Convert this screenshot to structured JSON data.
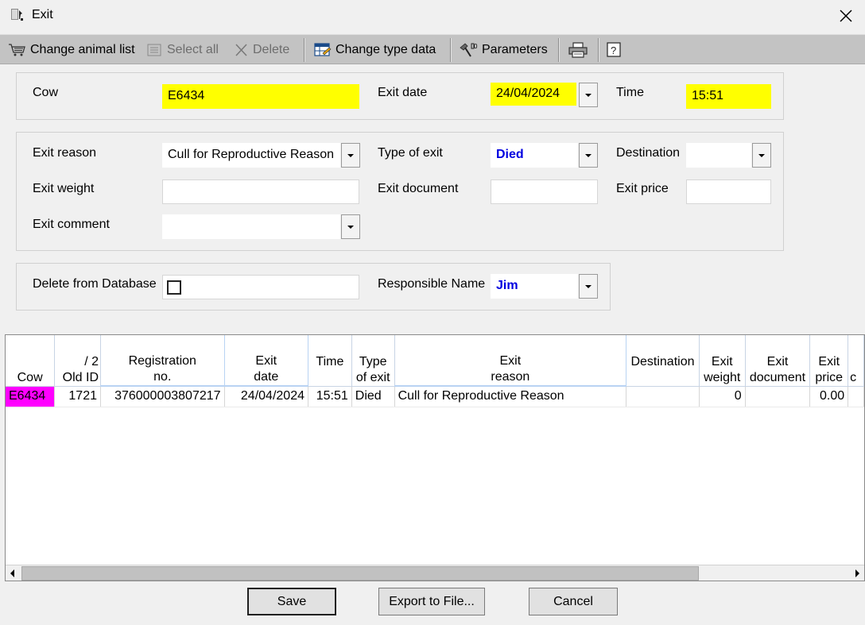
{
  "window": {
    "title": "Exit"
  },
  "toolbar": {
    "change_animal_list": "Change animal list",
    "select_all": "Select all",
    "delete": "Delete",
    "change_type_data": "Change type data",
    "parameters": "Parameters"
  },
  "header_form": {
    "cow_label": "Cow",
    "cow_value": "E6434",
    "exit_date_label": "Exit date",
    "exit_date_value": "24/04/2024",
    "time_label": "Time",
    "time_value": "15:51"
  },
  "details_form": {
    "exit_reason_label": "Exit reason",
    "exit_reason_value": "Cull for Reproductive Reason",
    "type_of_exit_label": "Type of exit",
    "type_of_exit_value": "Died",
    "destination_label": "Destination",
    "destination_value": "",
    "exit_weight_label": "Exit weight",
    "exit_weight_value": "",
    "exit_document_label": "Exit document",
    "exit_document_value": "",
    "exit_price_label": "Exit price",
    "exit_price_value": "",
    "exit_comment_label": "Exit comment",
    "exit_comment_value": ""
  },
  "db_form": {
    "delete_label": "Delete from Database",
    "delete_checked": false,
    "responsible_label": "Responsible Name",
    "responsible_value": "Jim"
  },
  "grid": {
    "sort_indicator": "/ 2",
    "columns": {
      "cow": "Cow",
      "old_id": "Old ID",
      "reg_1": "Registration",
      "reg_2": "no.",
      "date_1": "Exit",
      "date_2": "date",
      "time": "Time",
      "type_1": "Type",
      "type_2": "of exit",
      "reason_1": "Exit",
      "reason_2": "reason",
      "destination": "Destination",
      "weight_1": "Exit",
      "weight_2": "weight",
      "doc_1": "Exit",
      "doc_2": "document",
      "price_1": "Exit",
      "price_2": "price",
      "more": "c"
    },
    "rows": [
      {
        "cow": "E6434",
        "old_id": "1721",
        "registration_no": "376000003807217",
        "exit_date": "24/04/2024",
        "time": "15:51",
        "type_of_exit": "Died",
        "exit_reason": "Cull for Reproductive Reason",
        "destination": "",
        "exit_weight": "0",
        "exit_document": "",
        "exit_price": "0.00"
      }
    ]
  },
  "buttons": {
    "save": "Save",
    "export": "Export to File...",
    "cancel": "Cancel"
  },
  "colors": {
    "highlight_yellow": "#ffff00",
    "cow_cell_magenta": "#ff00ff",
    "accent_blue": "#0000e0"
  }
}
